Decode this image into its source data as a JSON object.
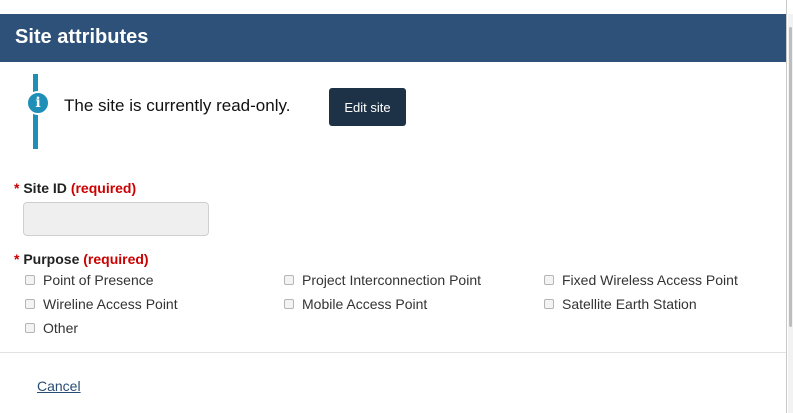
{
  "header": {
    "title": "Site attributes"
  },
  "notice": {
    "icon": "info-icon",
    "message": "The site is currently read-only.",
    "edit_button": "Edit site"
  },
  "site_id": {
    "star": "*",
    "label": "Site ID",
    "required": "(required)",
    "value": ""
  },
  "purpose": {
    "star": "*",
    "label": "Purpose",
    "required": "(required)",
    "options": [
      {
        "label": "Point of Presence",
        "checked": false
      },
      {
        "label": "Project Interconnection Point",
        "checked": false
      },
      {
        "label": "Fixed Wireless Access Point",
        "checked": false
      },
      {
        "label": "Wireline Access Point",
        "checked": false
      },
      {
        "label": "Mobile Access Point",
        "checked": false
      },
      {
        "label": "Satellite Earth Station",
        "checked": false
      },
      {
        "label": "Other",
        "checked": false
      }
    ]
  },
  "footer": {
    "cancel_label": "Cancel"
  },
  "colors": {
    "header_bg": "#2d5178",
    "info_accent": "#1f8fb8",
    "button_bg": "#1e3247",
    "required": "#cc0000"
  }
}
